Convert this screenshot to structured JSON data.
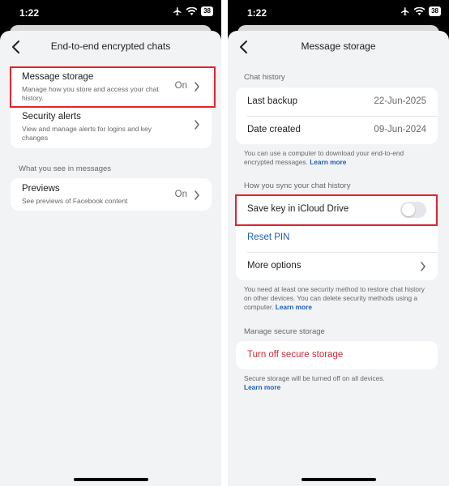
{
  "status_bar": {
    "time": "1:22",
    "battery": "38"
  },
  "left_screen": {
    "title": "End-to-end encrypted chats",
    "message_storage": {
      "title": "Message storage",
      "subtitle": "Manage how you store and access your chat history.",
      "value": "On"
    },
    "security_alerts": {
      "title": "Security alerts",
      "subtitle": "View and manage alerts for logins and key changes"
    },
    "section_header": "What you see in messages",
    "previews": {
      "title": "Previews",
      "subtitle": "See previews of Facebook content",
      "value": "On"
    }
  },
  "right_screen": {
    "title": "Message storage",
    "chat_history_header": "Chat history",
    "last_backup": {
      "label": "Last backup",
      "value": "22-Jun-2025"
    },
    "date_created": {
      "label": "Date created",
      "value": "09-Jun-2024"
    },
    "chat_history_note": "You can use a computer to download your end-to-end encrypted messages.",
    "learn_more": "Learn more",
    "sync_header": "How you sync your chat history",
    "save_key": {
      "label": "Save key in iCloud Drive",
      "enabled": false
    },
    "reset_pin": "Reset PIN",
    "more_options": "More options",
    "sync_note": "You need at least one security method to restore chat history on other devices. You can delete security methods using a computer.",
    "manage_header": "Manage secure storage",
    "turn_off": "Turn off secure storage",
    "storage_note": "Secure storage will be turned off on all devices."
  },
  "colors": {
    "link": "#1d5fb8",
    "destructive": "#c62b39",
    "highlight": "#e0242c"
  },
  "icons": [
    "back-chevron-icon",
    "airplane-icon",
    "wifi-icon",
    "battery-icon",
    "chevron-right-icon"
  ]
}
